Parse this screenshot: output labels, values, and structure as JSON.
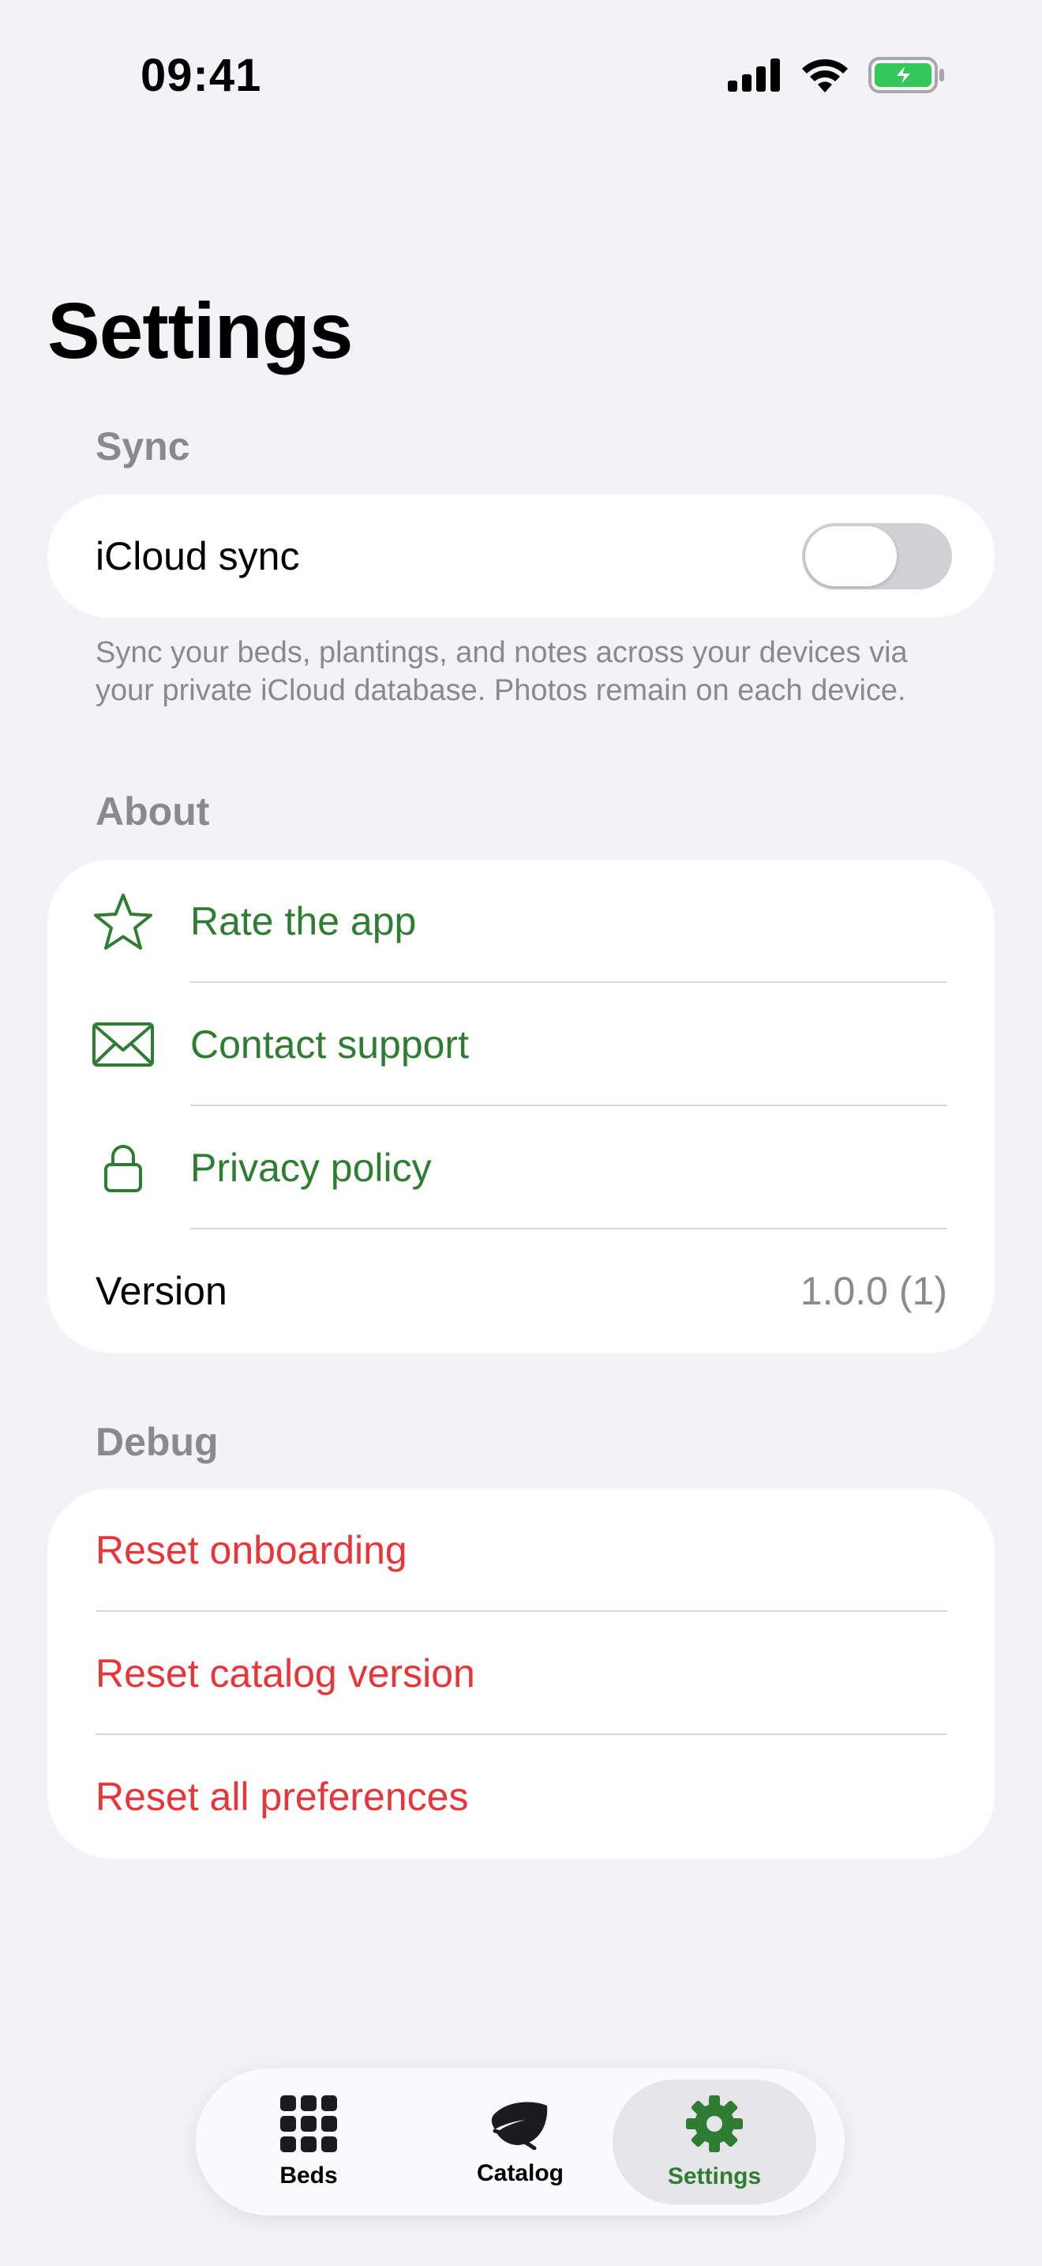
{
  "status_bar": {
    "time": "09:41"
  },
  "page": {
    "title": "Settings"
  },
  "sync": {
    "header": "Sync",
    "icloud_label": "iCloud sync",
    "icloud_enabled": false,
    "footnote": "Sync your beds, plantings, and notes across your devices via your private iCloud database. Photos remain on each device."
  },
  "about": {
    "header": "About",
    "items": [
      {
        "label": "Rate the app",
        "icon": "star-icon"
      },
      {
        "label": "Contact support",
        "icon": "envelope-icon"
      },
      {
        "label": "Privacy policy",
        "icon": "lock-icon"
      }
    ],
    "version_label": "Version",
    "version_value": "1.0.0 (1)"
  },
  "debug": {
    "header": "Debug",
    "items": [
      {
        "label": "Reset onboarding"
      },
      {
        "label": "Reset catalog version"
      },
      {
        "label": "Reset all preferences"
      }
    ]
  },
  "tabbar": {
    "tabs": [
      {
        "label": "Beds",
        "icon": "grid-icon",
        "active": false
      },
      {
        "label": "Catalog",
        "icon": "leaf-icon",
        "active": false
      },
      {
        "label": "Settings",
        "icon": "gear-icon",
        "active": true
      }
    ]
  },
  "colors": {
    "accent": "#2e7d32",
    "destructive": "#e8353a",
    "secondary": "#8a8a8e",
    "background": "#f2f2f7"
  }
}
